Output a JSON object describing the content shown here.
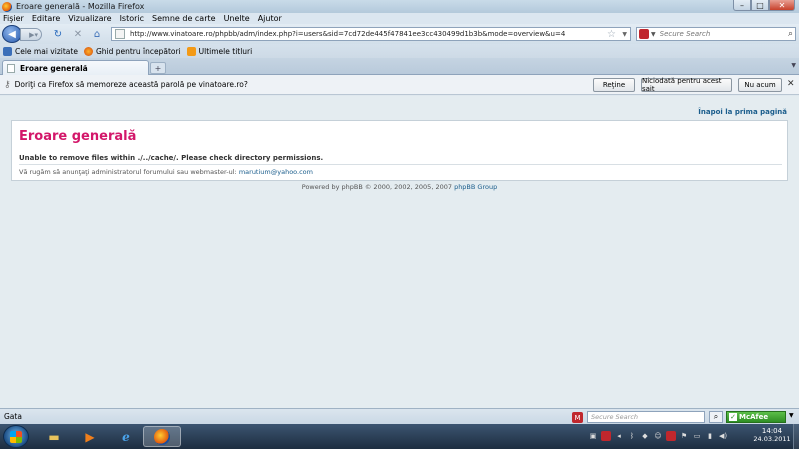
{
  "window": {
    "title": "Eroare generală - Mozilla Firefox"
  },
  "menu": [
    "Fişier",
    "Editare",
    "Vizualizare",
    "Istoric",
    "Semne de carte",
    "Unelte",
    "Ajutor"
  ],
  "nav": {
    "url": "http://www.vinatoare.ro/phpbb/adm/index.php?i=users&sid=7cd72de445f47841ee3cc430499d1b3b&mode=overview&u=4",
    "search_placeholder": "Secure Search"
  },
  "bookmarks": [
    "Cele mai vizitate",
    "Ghid pentru începători",
    "Ultimele titluri"
  ],
  "tabs": [
    {
      "label": "Eroare generală"
    }
  ],
  "notification": {
    "message": "Doriţi ca Firefox să memoreze această parolă pe vinatoare.ro?",
    "btn_remember": "Reţine",
    "btn_never": "Niciodată pentru acest sait",
    "btn_notnow": "Nu acum"
  },
  "page": {
    "back_link": "Înapoi la prima pagină",
    "error_title": "Eroare generală",
    "error_message": "Unable to remove files within ./../cache/. Please check directory permissions.",
    "contact_text": "Vă rugăm să anunţaţi administratorul forumului sau webmaster-ul: ",
    "contact_email": "marutium@yahoo.com",
    "powered_text": "Powered by phpBB © 2000, 2002, 2005, 2007 ",
    "powered_group": "phpBB Group"
  },
  "status": {
    "text": "Gata",
    "search_placeholder": "Secure Search",
    "mcafee": "McAfee"
  },
  "taskbar": {
    "time": "14:04",
    "date": "24.03.2011"
  },
  "colors": {
    "error_title": "#d3176a",
    "link": "#1a5d8c",
    "page_bg": "#e4ecf0"
  }
}
